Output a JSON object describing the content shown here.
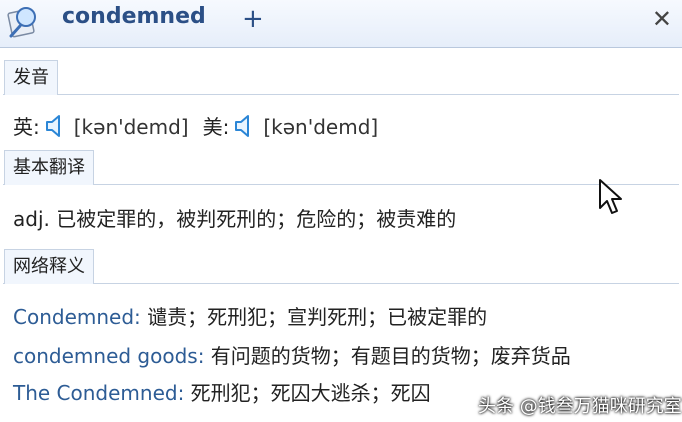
{
  "header": {
    "title": "condemned",
    "add_glyph": "+",
    "close_glyph": "✕"
  },
  "sections": {
    "pronunciation": {
      "heading": "发音",
      "uk_label": "英:",
      "uk_phonetic": "[kən'demd]",
      "us_label": "美:",
      "us_phonetic": "[kən'demd]"
    },
    "basic": {
      "heading": "基本翻译",
      "definition": "adj. 已被定罪的，被判死刑的；危险的；被责难的"
    },
    "web": {
      "heading": "网络释义",
      "entries": [
        {
          "term": "Condemned:",
          "meaning": " 谴责；死刑犯；宣判死刑；已被定罪的"
        },
        {
          "term": "condemned goods:",
          "meaning": " 有问题的货物；有题目的货物；废弃货品"
        },
        {
          "term": "The Condemned:",
          "meaning": " 死刑犯；死囚大逃杀；死囚"
        }
      ]
    }
  },
  "watermark": "头条 @钱叁万猫咪研究室",
  "colors": {
    "accent": "#2b4f86",
    "term": "#2d5c95",
    "tab_bg": "#f1f6fd",
    "rule": "#c7d3e3"
  },
  "icons": [
    "dictionary-logo-icon",
    "add-icon",
    "close-icon",
    "speaker-icon",
    "mouse-cursor-icon"
  ]
}
